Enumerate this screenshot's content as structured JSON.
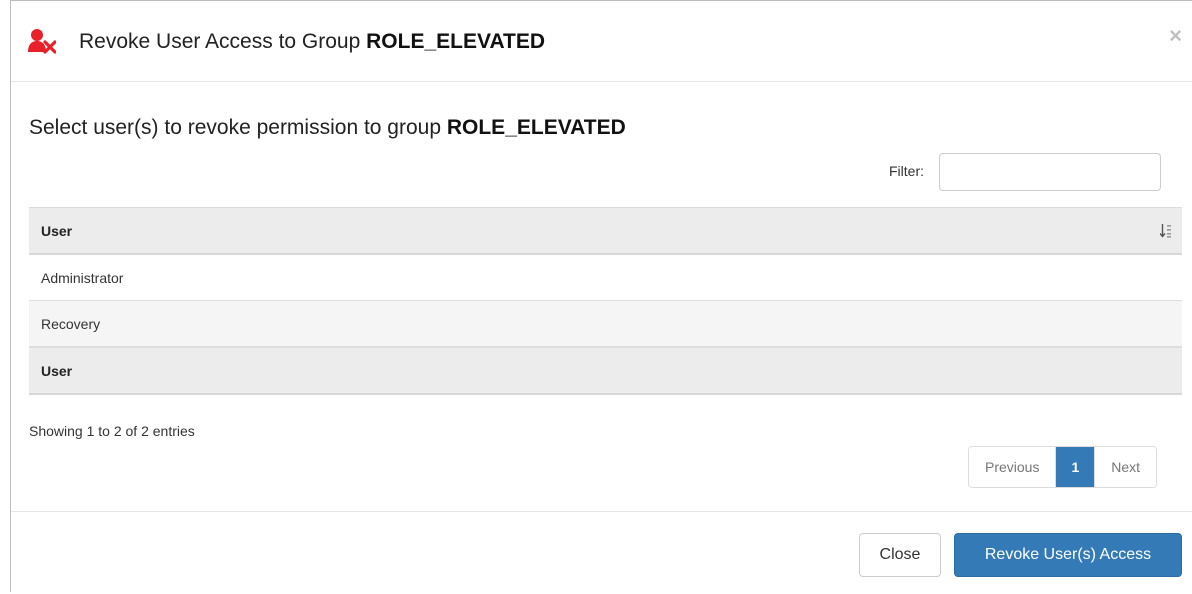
{
  "dialog": {
    "title_prefix": "Revoke User Access to Group",
    "title_group": "ROLE_ELEVATED",
    "close_glyph": "×",
    "icon": "user-remove-icon",
    "icon_color": "#e8202a"
  },
  "body": {
    "instruction_prefix": "Select user(s) to revoke permission to group",
    "instruction_group": "ROLE_ELEVATED",
    "filter_label": "Filter:",
    "filter_value": ""
  },
  "table": {
    "header": "User",
    "footer_header": "User",
    "rows": [
      "Administrator",
      "Recovery"
    ],
    "sort_icon": "sort-alpha-icon"
  },
  "pagination": {
    "info": "Showing 1 to 2 of 2 entries",
    "previous": "Previous",
    "current": "1",
    "next": "Next",
    "active_color": "#337ab7"
  },
  "footer": {
    "close_label": "Close",
    "revoke_label": "Revoke User(s) Access",
    "primary_color": "#337ab7"
  }
}
